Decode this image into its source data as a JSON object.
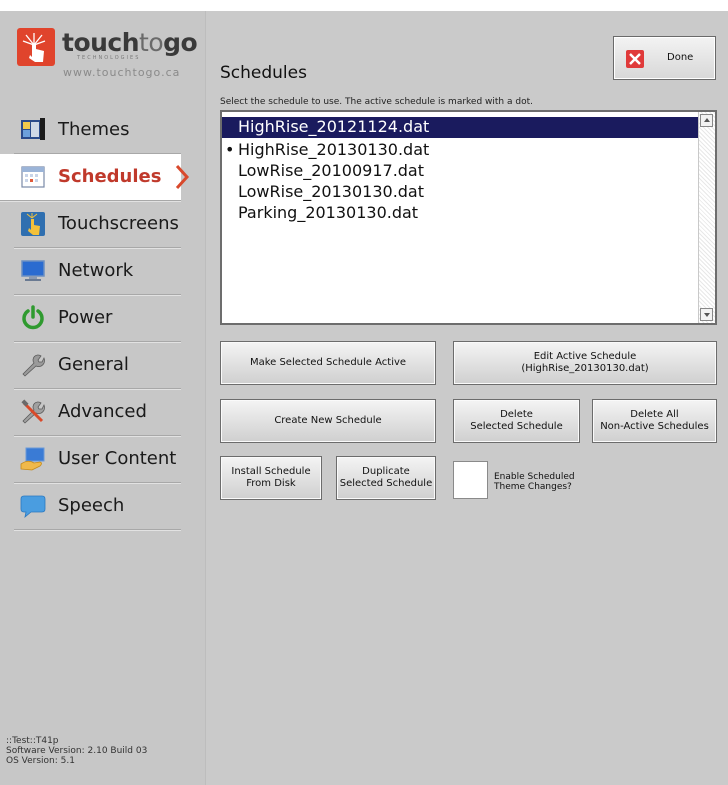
{
  "brand": {
    "name_bold": "touch",
    "name_to": "to",
    "name_go": "go",
    "sub": "TECHNOLOGIES",
    "url": "www.touchtogo.ca",
    "color": "#e0442c"
  },
  "sidebar": {
    "items": [
      {
        "label": "Themes",
        "icon": "themes-icon"
      },
      {
        "label": "Schedules",
        "icon": "calendar-icon",
        "active": true
      },
      {
        "label": "Touchscreens",
        "icon": "touch-icon"
      },
      {
        "label": "Network",
        "icon": "monitor-icon"
      },
      {
        "label": "Power",
        "icon": "power-icon"
      },
      {
        "label": "General",
        "icon": "wrench-icon"
      },
      {
        "label": "Advanced",
        "icon": "tools-icon"
      },
      {
        "label": "User Content",
        "icon": "user-content-icon"
      },
      {
        "label": "Speech",
        "icon": "speech-bubble-icon"
      }
    ],
    "status": {
      "line1": "::Test::T41p",
      "line2": "Software Version: 2.10 Build 03",
      "line3": "OS Version: 5.1"
    }
  },
  "main": {
    "title": "Schedules",
    "done_label": "Done",
    "hint": "Select the schedule to use. The active schedule is marked with a dot.",
    "schedules": [
      {
        "name": "HighRise_20121124.dat",
        "selected": true,
        "active": false
      },
      {
        "name": "HighRise_20130130.dat",
        "selected": false,
        "active": true
      },
      {
        "name": "LowRise_20100917.dat",
        "selected": false,
        "active": false
      },
      {
        "name": "LowRise_20130130.dat",
        "selected": false,
        "active": false
      },
      {
        "name": "Parking_20130130.dat",
        "selected": false,
        "active": false
      }
    ],
    "active_marker": "•",
    "buttons": {
      "make_active": "Make Selected Schedule Active",
      "edit_active": "Edit Active Schedule\n(HighRise_20130130.dat)",
      "create_new": "Create New Schedule",
      "delete_selected": "Delete\nSelected Schedule",
      "delete_all": "Delete All\nNon-Active Schedules",
      "install_disk": "Install Schedule\nFrom Disk",
      "duplicate": "Duplicate\nSelected Schedule"
    },
    "enable_theme_changes": {
      "label": "Enable Scheduled\nTheme Changes?",
      "checked": false
    }
  },
  "colors": {
    "selection": "#1a1b5e",
    "active_nav_text": "#c0392b",
    "done_icon": "#e03a3a"
  }
}
